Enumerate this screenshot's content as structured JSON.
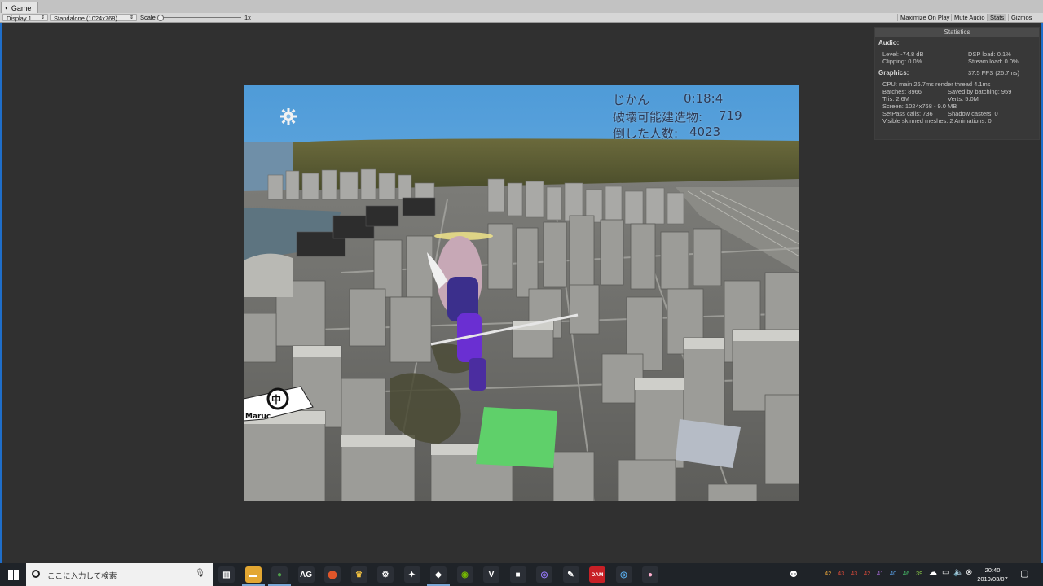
{
  "window": {
    "tab_label": "Game",
    "display": "Display 1",
    "resolution": "Standalone (1024x768)",
    "scale_label": "Scale",
    "scale_value": "1x",
    "buttons": {
      "maximize": "Maximize On Play",
      "mute": "Mute Audio",
      "stats": "Stats",
      "gizmos": "Gizmos"
    }
  },
  "hud": {
    "time_label": "じかん",
    "time_value": "0:18:4",
    "buildings_label": "破壊可能建造物:",
    "buildings_value": "719",
    "people_label": "倒した人数:",
    "people_value": "4023",
    "sign_text": "Maruc"
  },
  "stats": {
    "title": "Statistics",
    "audio_title": "Audio:",
    "level": "Level: -74.8 dB",
    "clipping": "Clipping: 0.0%",
    "dsp_load": "DSP load: 0.1%",
    "stream_load": "Stream load: 0.0%",
    "graphics_title": "Graphics:",
    "fps": "37.5 FPS (26.7ms)",
    "cpu": "CPU: main 26.7ms  render thread 4.1ms",
    "batches": "Batches: 8966",
    "saved_batching": "Saved by batching: 959",
    "tris": "Tris: 2.6M",
    "verts": "Verts: 5.0M",
    "screen": "Screen: 1024x768 - 9.0 MB",
    "setpass": "SetPass calls: 736",
    "shadow": "Shadow casters: 0",
    "skinned": "Visible skinned meshes: 2  Animations: 0"
  },
  "taskbar": {
    "search_placeholder": "ここに入力して検索",
    "tray_numbers": [
      "42",
      "43",
      "43",
      "42",
      "41",
      "40",
      "46",
      "39"
    ],
    "tray_colors": [
      "#e6a33a",
      "#d84a3a",
      "#d84a3a",
      "#d84a3a",
      "#a56ad6",
      "#5aa0e6",
      "#48c06a",
      "#8fd04a"
    ],
    "time": "20:40",
    "date": "2019/03/07",
    "apps": [
      {
        "name": "task-view-icon",
        "label": ""
      },
      {
        "name": "file-explorer-icon",
        "label": ""
      },
      {
        "name": "chrome-icon",
        "label": ""
      },
      {
        "name": "ag-app-icon",
        "label": "AG"
      },
      {
        "name": "maps-pin-icon",
        "label": ""
      },
      {
        "name": "figure-app-icon",
        "label": ""
      },
      {
        "name": "steam-icon",
        "label": ""
      },
      {
        "name": "blender-figure-icon",
        "label": ""
      },
      {
        "name": "unity-icon",
        "label": ""
      },
      {
        "name": "nvidia-icon",
        "label": ""
      },
      {
        "name": "v-app-icon",
        "label": "V"
      },
      {
        "name": "square-app-icon",
        "label": ""
      },
      {
        "name": "eye-app-icon",
        "label": ""
      },
      {
        "name": "inkscape-icon",
        "label": ""
      },
      {
        "name": "dam-app-icon",
        "label": "DAM"
      },
      {
        "name": "swirl-app-icon",
        "label": ""
      },
      {
        "name": "balloon-app-icon",
        "label": ""
      }
    ]
  },
  "colors": {
    "accent": "#1f6ec9",
    "editor_bg": "#303030",
    "sky": "#5aa0d8"
  }
}
